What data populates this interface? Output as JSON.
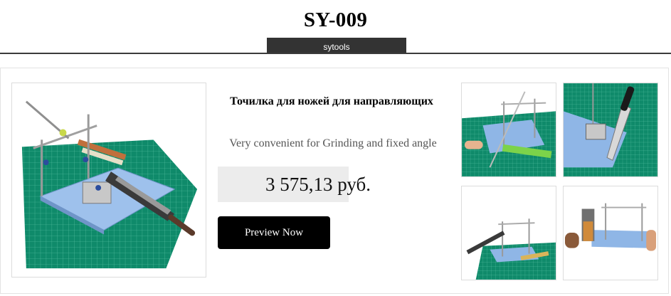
{
  "header": {
    "title": "SY-009",
    "brand": "sytools"
  },
  "product": {
    "name": "Точилка для ножей для направляющих",
    "description": "Very convenient for Grinding and fixed angle",
    "price": "3 575,13 руб.",
    "cta_label": "Preview Now"
  },
  "images": {
    "main": "product-main-photo",
    "thumbnails": [
      "thumbnail-photo-1",
      "thumbnail-photo-2",
      "thumbnail-photo-3",
      "thumbnail-photo-4"
    ]
  },
  "colors": {
    "mat_green": "#0f8a6a",
    "base_blue": "#8fb6e6",
    "button_bg": "#000000",
    "tab_bg": "#333333",
    "price_bg": "#ececec"
  }
}
